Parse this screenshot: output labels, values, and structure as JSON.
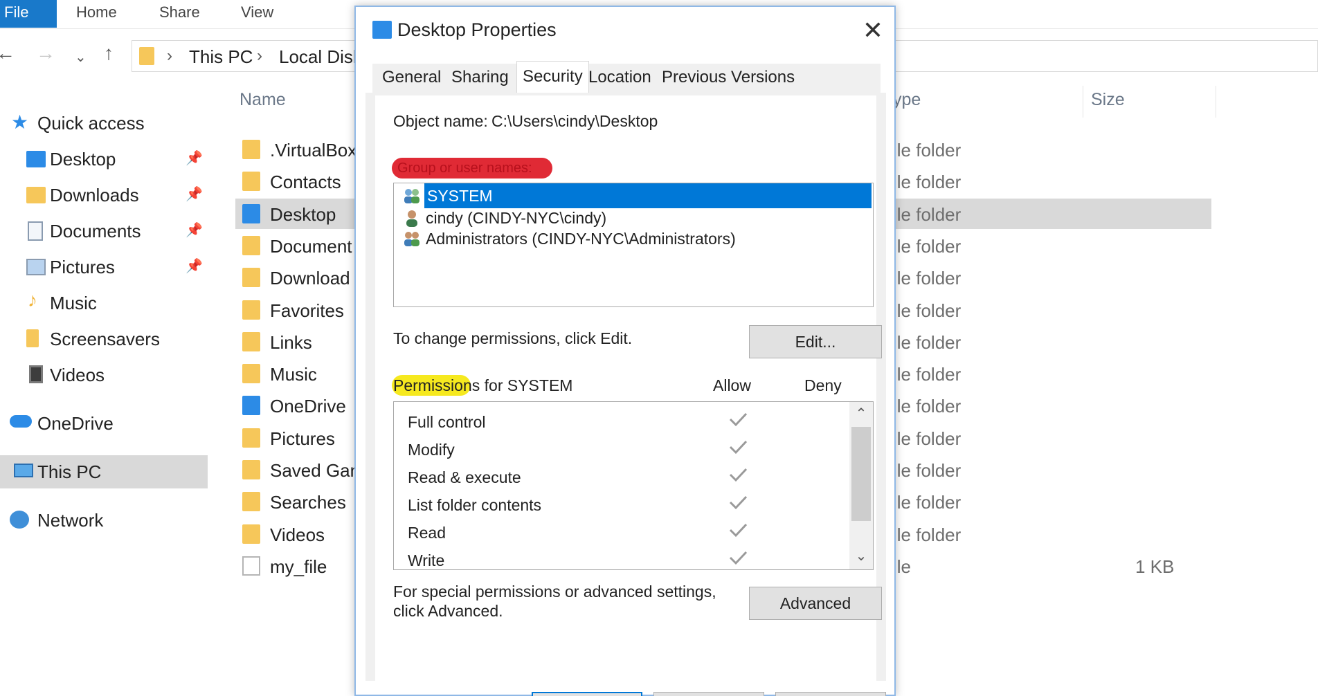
{
  "ribbon": {
    "tabs": [
      "File",
      "Home",
      "Share",
      "View"
    ]
  },
  "address": {
    "segments": [
      "This PC",
      "Local Disk"
    ]
  },
  "navpane": {
    "items": [
      {
        "label": "Quick access",
        "icon": "star-icon"
      },
      {
        "label": "Desktop",
        "icon": "desktop-folder-icon",
        "pinned": true
      },
      {
        "label": "Downloads",
        "icon": "downloads-folder-icon",
        "pinned": true
      },
      {
        "label": "Documents",
        "icon": "documents-folder-icon",
        "pinned": true
      },
      {
        "label": "Pictures",
        "icon": "pictures-folder-icon",
        "pinned": true
      },
      {
        "label": "Music",
        "icon": "music-folder-icon"
      },
      {
        "label": "Screensavers",
        "icon": "folder-icon"
      },
      {
        "label": "Videos",
        "icon": "videos-folder-icon"
      },
      {
        "label": "OneDrive",
        "icon": "cloud-icon"
      },
      {
        "label": "This PC",
        "icon": "computer-icon",
        "selected": true
      },
      {
        "label": "Network",
        "icon": "network-icon"
      }
    ]
  },
  "filelist": {
    "columns": {
      "name": "Name",
      "type": "ype",
      "size": "Size"
    },
    "rows": [
      {
        "name": ".VirtualBox",
        "type": "ile folder",
        "size": ""
      },
      {
        "name": "Contacts",
        "type": "ile folder",
        "size": ""
      },
      {
        "name": "Desktop",
        "type": "ile folder",
        "size": "",
        "selected": true
      },
      {
        "name": "Document",
        "type": "ile folder",
        "size": ""
      },
      {
        "name": "Download",
        "type": "ile folder",
        "size": ""
      },
      {
        "name": "Favorites",
        "type": "ile folder",
        "size": ""
      },
      {
        "name": "Links",
        "type": "ile folder",
        "size": ""
      },
      {
        "name": "Music",
        "type": "ile folder",
        "size": ""
      },
      {
        "name": "OneDrive",
        "type": "ile folder",
        "size": ""
      },
      {
        "name": "Pictures",
        "type": "ile folder",
        "size": ""
      },
      {
        "name": "Saved Gan",
        "type": "ile folder",
        "size": ""
      },
      {
        "name": "Searches",
        "type": "ile folder",
        "size": ""
      },
      {
        "name": "Videos",
        "type": "ile folder",
        "size": ""
      },
      {
        "name": "my_file",
        "type": "ile",
        "size": "1 KB"
      }
    ]
  },
  "dialog": {
    "title": "Desktop Properties",
    "tabs": [
      "General",
      "Sharing",
      "Security",
      "Location",
      "Previous Versions"
    ],
    "active_tab": "Security",
    "object_name_label": "Object name:",
    "object_name_value": "C:\\Users\\cindy\\Desktop",
    "groups_label": "Group or user names:",
    "users": [
      {
        "label": "SYSTEM",
        "selected": true
      },
      {
        "label": "cindy (CINDY-NYC\\cindy)"
      },
      {
        "label": "Administrators (CINDY-NYC\\Administrators)"
      }
    ],
    "change_text": "To change permissions, click Edit.",
    "edit_button": "Edit...",
    "permissions_title": "Permissions for SYSTEM",
    "allow_header": "Allow",
    "deny_header": "Deny",
    "permissions": [
      {
        "name": "Full control",
        "allow": true
      },
      {
        "name": "Modify",
        "allow": true
      },
      {
        "name": "Read & execute",
        "allow": true
      },
      {
        "name": "List folder contents",
        "allow": true
      },
      {
        "name": "Read",
        "allow": true
      },
      {
        "name": "Write",
        "allow": true
      }
    ],
    "advanced_text_1": "For special permissions or advanced settings,",
    "advanced_text_2": "click Advanced.",
    "advanced_button": "Advanced"
  },
  "colors": {
    "accent": "#0078d7",
    "ribbon_file": "#1979ca",
    "annotation_red": "#e02a35",
    "annotation_yellow": "#f6e91f"
  }
}
